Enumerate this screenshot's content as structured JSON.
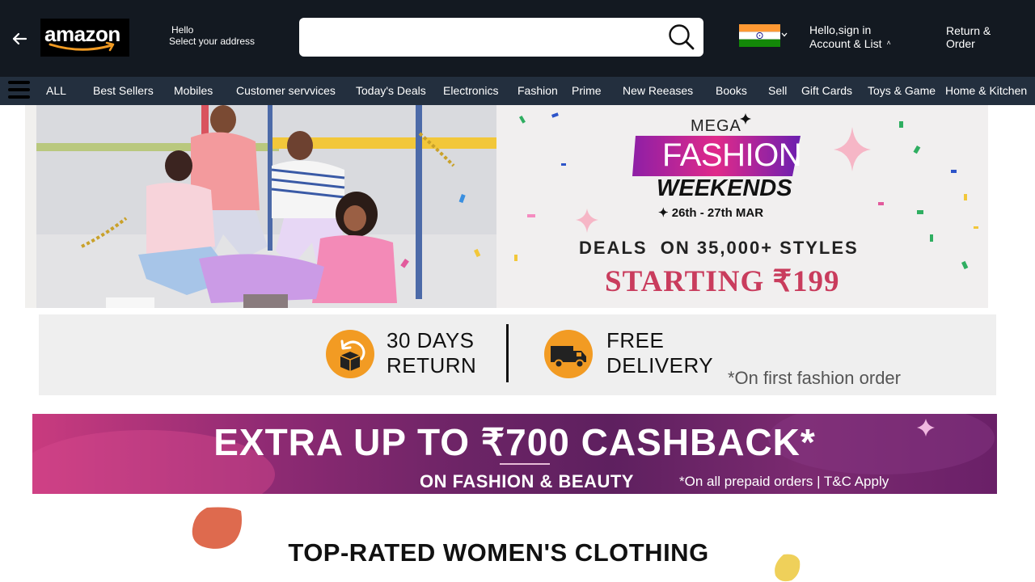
{
  "header": {
    "logo_text": "amazon",
    "address_line1": "Hello",
    "address_line2": "Select your address",
    "search_placeholder": "",
    "account_line1": "Hello,sign in",
    "account_line2": "Account & List",
    "account_caret": "˄",
    "returns_line1": "Return &",
    "returns_line2": "Order"
  },
  "nav": {
    "items": [
      "ALL",
      "Best Sellers",
      "Mobiles",
      "Customer servvices",
      "Today's Deals",
      "Electronics",
      "Fashion",
      "Prime",
      "New Reeases",
      "Books",
      "Sell",
      "Gift Cards",
      "Toys & Game",
      "Home & Kitchen"
    ]
  },
  "hero": {
    "mega": "MEGA",
    "fashion": "FASHION",
    "weekends": "WEEKENDS",
    "dates": "✦ 26th - 27th MAR",
    "deals": "DEALS  ON 35,000+ STYLES",
    "starting": "STARTING ₹199"
  },
  "benefits": {
    "return_line1": "30 DAYS",
    "return_line2": "RETURN",
    "delivery_line1": "FREE",
    "delivery_line2": "DELIVERY",
    "footnote": "*On first fashion order"
  },
  "cashback": {
    "title": "EXTRA UP TO ₹700 CASHBACK*",
    "subtitle": "ON FASHION & BEAUTY",
    "note": "*On all prepaid orders | T&C Apply"
  },
  "section": {
    "title": "TOP-RATED WOMEN'S CLOTHING"
  },
  "colors": {
    "header_bg": "#131921",
    "nav_bg": "#232f3e",
    "accent_orange": "#f29b23",
    "benefit_bg": "#efefef"
  }
}
